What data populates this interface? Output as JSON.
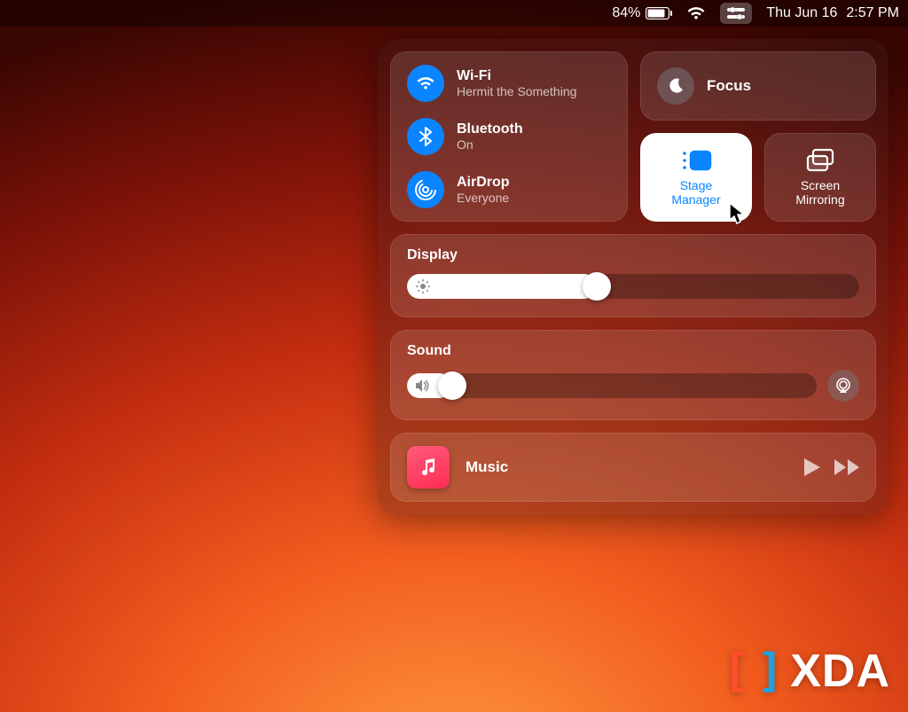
{
  "menubar": {
    "battery_percent": "84%",
    "date": "Thu Jun 16",
    "time": "2:57 PM"
  },
  "control_center": {
    "wifi": {
      "title": "Wi-Fi",
      "status": "Hermit the Something",
      "on": true
    },
    "bluetooth": {
      "title": "Bluetooth",
      "status": "On",
      "on": true
    },
    "airdrop": {
      "title": "AirDrop",
      "status": "Everyone",
      "on": true
    },
    "focus": {
      "title": "Focus",
      "on": false
    },
    "stage_manager": {
      "label": "Stage\nManager",
      "active": true
    },
    "screen_mirroring": {
      "label": "Screen\nMirroring",
      "active": false
    },
    "display": {
      "label": "Display",
      "brightness_percent": 42
    },
    "sound": {
      "label": "Sound",
      "volume_percent": 8
    },
    "music": {
      "label": "Music"
    }
  },
  "watermark": {
    "text": "XDA"
  }
}
